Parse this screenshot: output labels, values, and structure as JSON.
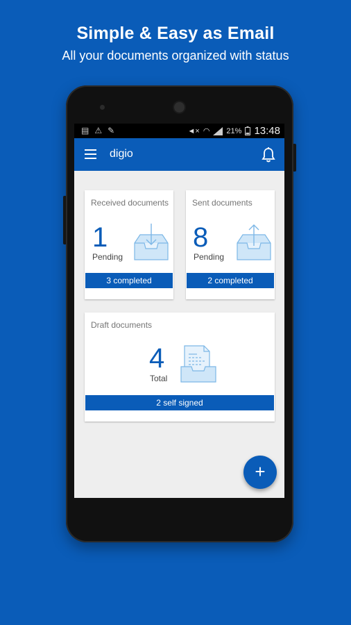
{
  "promo": {
    "headline": "Simple & Easy as Email",
    "subline": "All your documents organized with status"
  },
  "status_bar": {
    "battery": "21%",
    "time": "13:48"
  },
  "app_bar": {
    "title": "digio"
  },
  "cards": {
    "received": {
      "label": "Received documents",
      "count": "1",
      "count_label": "Pending",
      "footer": "3 completed"
    },
    "sent": {
      "label": "Sent documents",
      "count": "8",
      "count_label": "Pending",
      "footer": "2 completed"
    },
    "draft": {
      "label": "Draft documents",
      "count": "4",
      "count_label": "Total",
      "footer": "2 self signed"
    }
  },
  "fab": {
    "label": "+"
  },
  "colors": {
    "primary": "#0a5cb8",
    "background": "#eeeeee",
    "icon_light": "#cfe6f8",
    "icon_stroke": "#7cb7e6"
  },
  "icons": [
    "menu-icon",
    "bell-icon",
    "inbox-download-icon",
    "inbox-upload-icon",
    "draft-document-tray-icon",
    "add-icon"
  ]
}
